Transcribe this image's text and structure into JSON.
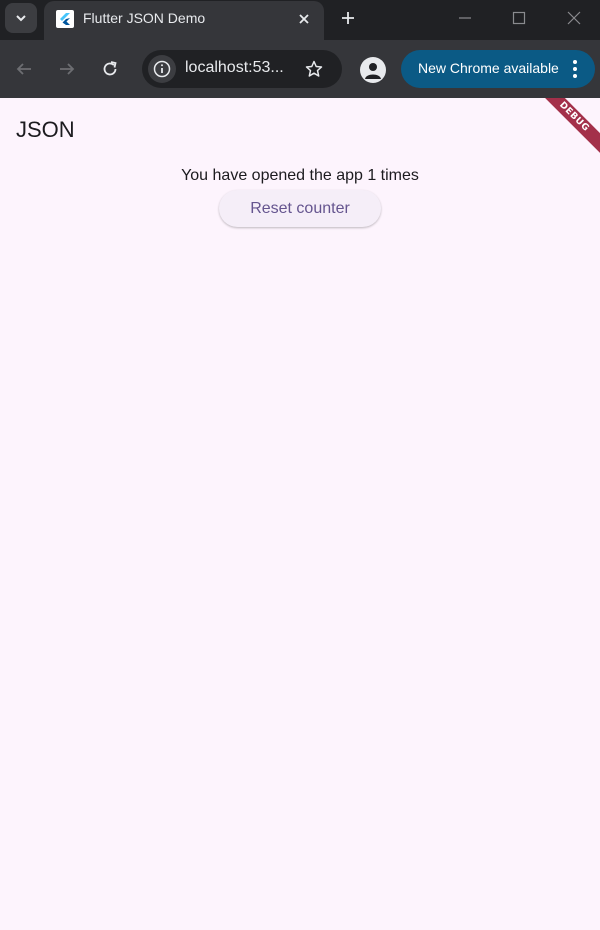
{
  "browser": {
    "tab": {
      "title": "Flutter JSON Demo",
      "favicon": "flutter-icon"
    },
    "icons": {
      "tab_search": "chevron-down-icon",
      "tab_close": "close-icon",
      "new_tab": "plus-icon",
      "minimize": "minimize-icon",
      "maximize": "maximize-icon",
      "close_window": "close-icon",
      "back": "arrow-left-icon",
      "forward": "arrow-right-icon",
      "reload": "reload-icon",
      "site_info": "info-icon",
      "bookmark": "star-icon",
      "profile": "person-icon",
      "menu": "kebab-menu-icon"
    },
    "address_bar": {
      "url": "localhost:53..."
    },
    "update_button": {
      "label": "New Chrome available"
    },
    "colors": {
      "tabstrip": "#202124",
      "toolbar": "#35363a",
      "update_button": "#0b5a85"
    }
  },
  "app": {
    "title": "JSON",
    "counter_message": "You have opened the app 1 times",
    "reset_button_label": "Reset counter",
    "debug_banner": "DEBUG",
    "colors": {
      "background": "#fdf4fd",
      "button_text": "#65558f",
      "debug_banner": "#a3304a"
    }
  }
}
